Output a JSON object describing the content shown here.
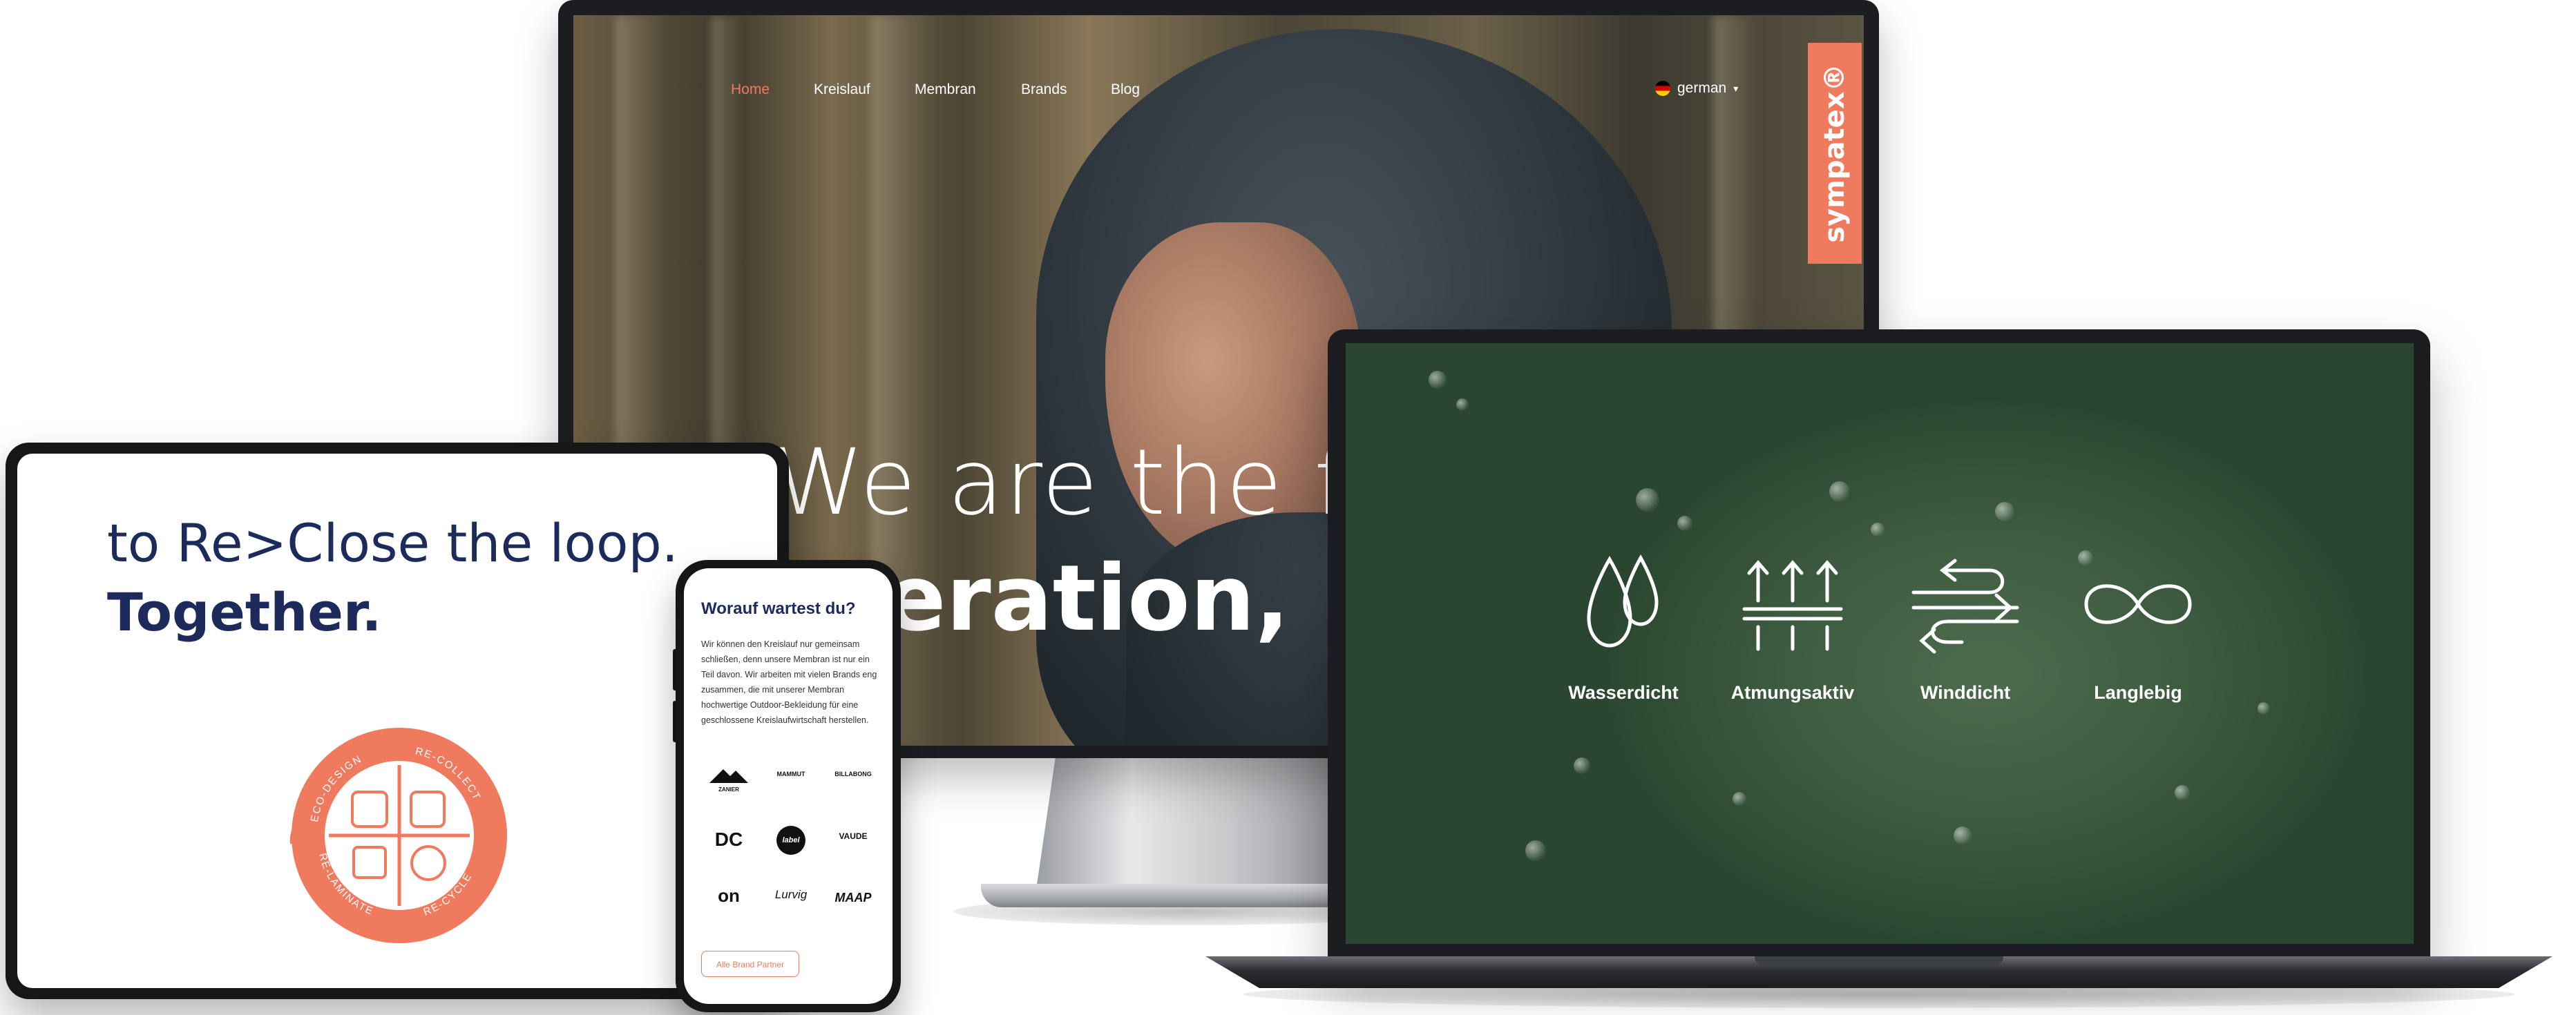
{
  "monitor": {
    "nav": {
      "items": [
        {
          "label": "Home",
          "active": true
        },
        {
          "label": "Kreislauf",
          "active": false
        },
        {
          "label": "Membran",
          "active": false
        },
        {
          "label": "Brands",
          "active": false
        },
        {
          "label": "Blog",
          "active": false
        }
      ],
      "language": "german"
    },
    "brand": "sympatex®",
    "hero": {
      "line1": "We are the first",
      "line2": "eration,"
    }
  },
  "laptop": {
    "features": [
      {
        "icon": "water-drops-icon",
        "label": "Wasserdicht"
      },
      {
        "icon": "breathable-arrows-icon",
        "label": "Atmungsaktiv"
      },
      {
        "icon": "wind-icon",
        "label": "Winddicht"
      },
      {
        "icon": "infinity-icon",
        "label": "Langlebig"
      }
    ]
  },
  "tablet": {
    "line1": "to Re>Close the loop.",
    "line2": "Together.",
    "badge": {
      "top_left": "ECO-DESIGN",
      "top_right": "RE-COLLECT",
      "bottom_left": "RE-LAMINATE",
      "bottom_right": "RE-CYCLE"
    }
  },
  "phone": {
    "heading": "Worauf wartest du?",
    "body": "Wir können den Kreislauf nur gemeinsam schließen, denn unsere Membran ist nur ein Teil davon. Wir arbeiten mit vielen Brands eng zusammen, die mit unserer Membran hochwertige Outdoor-Bekleidung für eine geschlossene Kreislaufwirtschaft herstellen.",
    "logos": [
      "ZANIER",
      "MAMMUT",
      "BILLABONG",
      "DC",
      "label",
      "VAUDE",
      "on",
      "Lurvig",
      "MAAP"
    ],
    "button": "Alle Brand Partner"
  },
  "colors": {
    "accent": "#f07a5e",
    "navy": "#1d2a5c",
    "laptop_bg": "#3c5a3f"
  }
}
